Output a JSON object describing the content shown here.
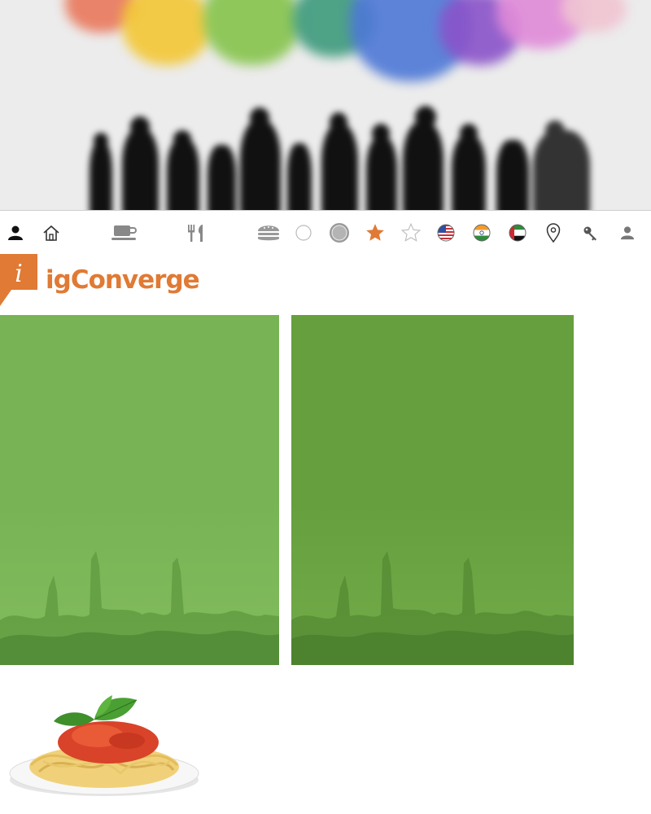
{
  "brand": {
    "logo_initial": "i",
    "name": "igConverge",
    "color": "#e07a34"
  },
  "hero": {
    "image": "colorful-speech-bubbles-over-people-silhouettes"
  },
  "toolbar": {
    "icons": [
      "user-black-icon",
      "home-icon",
      "coffee-cup-icon",
      "fork-knife-icon",
      "burger-icon",
      "circle-outline-icon",
      "circle-filled-icon",
      "star-filled-icon",
      "star-outline-icon",
      "us-flag-icon",
      "india-flag-icon",
      "uae-flag-icon",
      "location-pin-icon",
      "key-icon",
      "user-gray-icon"
    ],
    "accent": "#e07a34"
  },
  "cards": [
    {
      "image": "concert-crowd-green-overlay",
      "color": "#78b456"
    },
    {
      "image": "concert-crowd-green-overlay",
      "color": "#66a03e"
    }
  ],
  "food_image": "spaghetti-plate"
}
